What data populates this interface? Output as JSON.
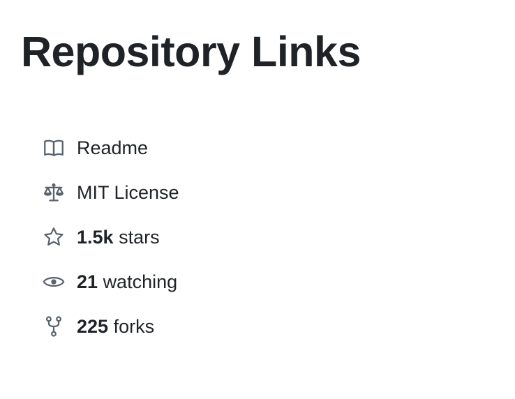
{
  "page": {
    "title": "Repository Links"
  },
  "links": [
    {
      "icon": "book-icon",
      "label": "Readme"
    },
    {
      "icon": "scale-icon",
      "label": "MIT License"
    },
    {
      "icon": "star-icon",
      "count": "1.5k",
      "label": "stars"
    },
    {
      "icon": "eye-icon",
      "count": "21",
      "label": "watching"
    },
    {
      "icon": "fork-icon",
      "count": "225",
      "label": "forks"
    }
  ],
  "colors": {
    "text": "#1f2328",
    "icon": "#59636e",
    "background": "#ffffff"
  }
}
